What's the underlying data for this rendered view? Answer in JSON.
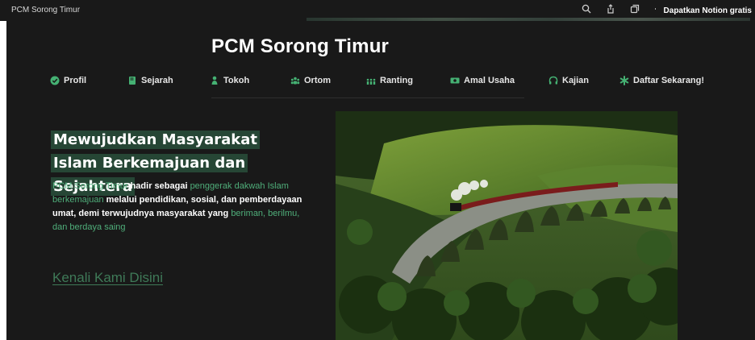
{
  "window": {
    "tab_title": "PCM Sorong Timur",
    "cta_label": "Dapatkan Notion gratis"
  },
  "page": {
    "title": "PCM Sorong Timur"
  },
  "nav": [
    {
      "label": "Profil",
      "icon": "check-badge-icon"
    },
    {
      "label": "Sejarah",
      "icon": "book-icon"
    },
    {
      "label": "Tokoh",
      "icon": "person-icon"
    },
    {
      "label": "Ortom",
      "icon": "group-icon"
    },
    {
      "label": "Ranting",
      "icon": "people-icon"
    },
    {
      "label": "Amal Usaha",
      "icon": "money-icon"
    },
    {
      "label": "Kajian",
      "icon": "headphones-icon"
    },
    {
      "label": "Daftar Sekarang!",
      "icon": "asterisk-icon"
    }
  ],
  "hero": {
    "headline": "Mewujudkan Masyarakat Islam Berkemajuan dan Sejahtera",
    "desc_parts": [
      "PCM Sorong Timur",
      " hadir sebagai ",
      "penggerak dakwah Islam berkemajuan",
      " melalui pendidikan, sosial, dan pemberdayaan umat, demi terwujudnya masyarakat yang ",
      "beriman, berilmu, dan berdaya saing"
    ],
    "cta_link": "Kenali Kami Disini",
    "image_alt": "Kereta uap melintasi jembatan viaduk di lembah hijau"
  },
  "colors": {
    "accent_green": "#4fae7a",
    "highlight_bg": "#264635",
    "link_green": "#3f7a58",
    "background": "#191919"
  }
}
